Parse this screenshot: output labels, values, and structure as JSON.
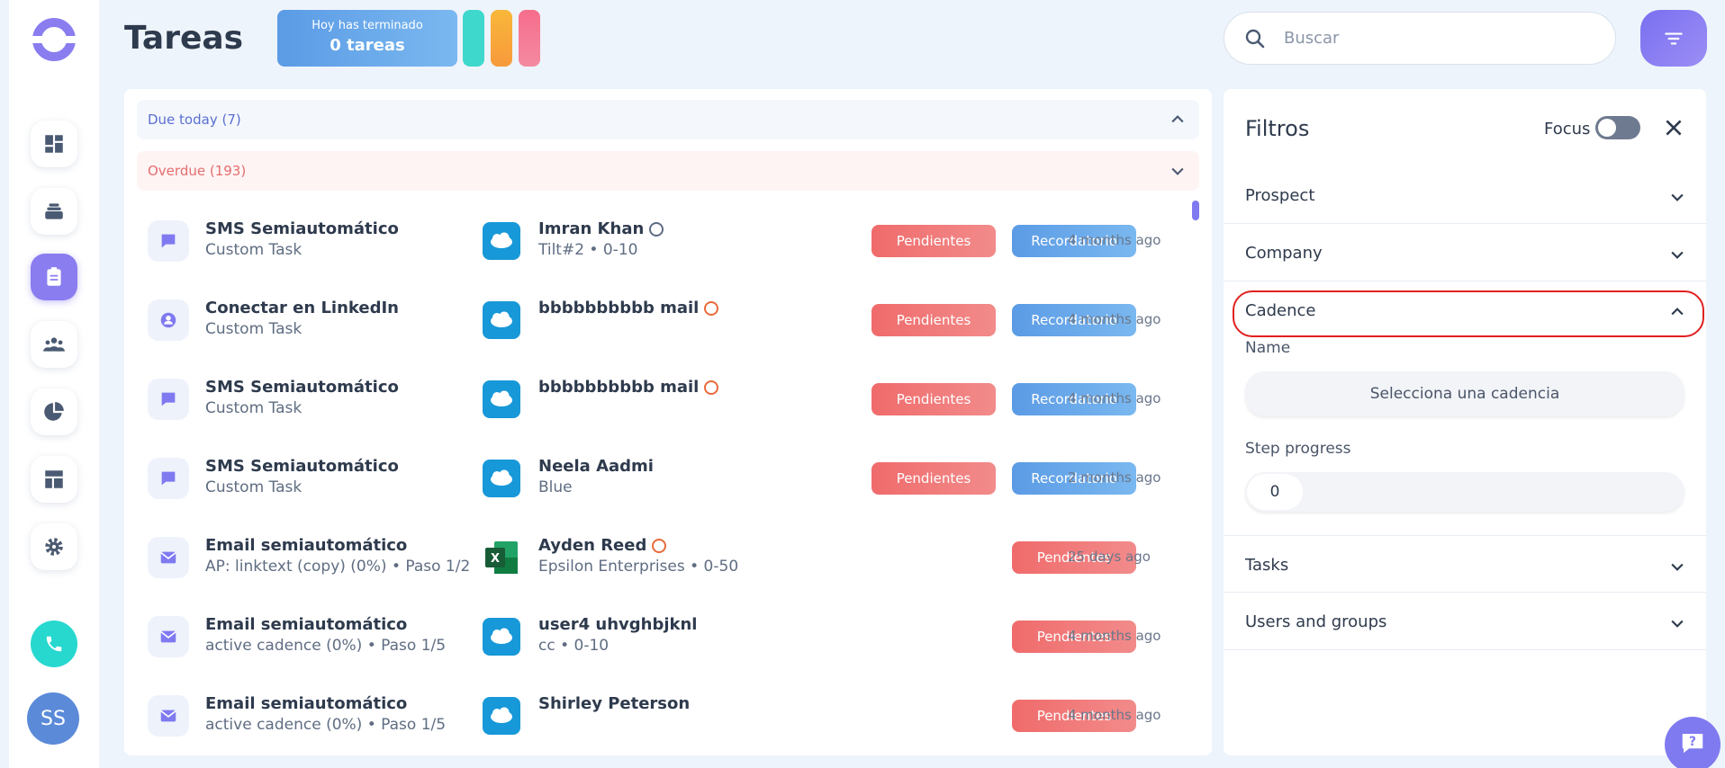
{
  "header": {
    "title": "Tareas",
    "done_small": "Hoy has terminado",
    "done_big": "0 tareas",
    "search_placeholder": "Buscar"
  },
  "sidebar": {
    "items": [
      {
        "name": "dashboard-icon"
      },
      {
        "name": "inbox-icon"
      },
      {
        "name": "tasks-icon",
        "active": true
      },
      {
        "name": "people-icon"
      },
      {
        "name": "reports-icon"
      },
      {
        "name": "layout-icon"
      },
      {
        "name": "gear-icon"
      }
    ],
    "avatar_initials": "SS"
  },
  "groups": {
    "due": "Due today (7)",
    "overdue": "Overdue (193)"
  },
  "tasks": [
    {
      "icon": "sms-icon",
      "title": "SMS Semiautomático",
      "sub": "Custom Task",
      "source": "salesforce",
      "contact": "Imran Khan",
      "globe": "grey",
      "contact_sub": "Tilt#2 • 0-10",
      "badges": [
        "Pendientes",
        "Recordatorio"
      ],
      "time": "4 months ago"
    },
    {
      "icon": "linkedin-icon",
      "title": "Conectar en LinkedIn",
      "sub": "Custom Task",
      "source": "salesforce",
      "contact": "bbbbbbbbbb mail",
      "globe": "orange",
      "contact_sub": "",
      "badges": [
        "Pendientes",
        "Recordatorio"
      ],
      "time": "4 months ago"
    },
    {
      "icon": "sms-icon",
      "title": "SMS Semiautomático",
      "sub": "Custom Task",
      "source": "salesforce",
      "contact": "bbbbbbbbbb mail",
      "globe": "orange",
      "contact_sub": "",
      "badges": [
        "Pendientes",
        "Recordatorio"
      ],
      "time": "4 months ago"
    },
    {
      "icon": "sms-icon",
      "title": "SMS Semiautomático",
      "sub": "Custom Task",
      "source": "salesforce",
      "contact": "Neela Aadmi",
      "globe": "",
      "contact_sub": "Blue",
      "badges": [
        "Pendientes",
        "Recordatorio"
      ],
      "time": "2 months ago"
    },
    {
      "icon": "email-icon",
      "title": "Email semiautomático",
      "sub": "AP: linktext (copy) (0%) • Paso 1/2",
      "source": "excel",
      "contact": "Ayden Reed",
      "globe": "orange",
      "contact_sub": "Epsilon Enterprises • 0-50",
      "badges": [
        "Pendientes"
      ],
      "time": "25 days ago"
    },
    {
      "icon": "email-icon",
      "title": "Email semiautomático",
      "sub": "active cadence (0%) • Paso 1/5",
      "source": "salesforce",
      "contact": "user4 uhvghbjknl",
      "globe": "",
      "contact_sub": "cc • 0-10",
      "badges": [
        "Pendientes"
      ],
      "time": "4 months ago"
    },
    {
      "icon": "email-icon",
      "title": "Email semiautomático",
      "sub": "active cadence (0%) • Paso 1/5",
      "source": "salesforce",
      "contact": "Shirley Peterson",
      "globe": "",
      "contact_sub": "",
      "badges": [
        "Pendientes"
      ],
      "time": "4 months ago"
    }
  ],
  "filters": {
    "title": "Filtros",
    "focus_label": "Focus",
    "sections": {
      "prospect": "Prospect",
      "company": "Company",
      "cadence": "Cadence",
      "tasks": "Tasks",
      "users": "Users and groups"
    },
    "cadence_name_label": "Name",
    "cadence_select": "Selecciona una cadencia",
    "step_label": "Step progress",
    "step_value": "0"
  },
  "colors": {
    "accent": "#8a7df0",
    "pending": "#f06b6b",
    "reminder": "#5b9be5",
    "teal": "#27d8cf",
    "orange": "#f7a93b",
    "pink": "#f06b8f"
  }
}
